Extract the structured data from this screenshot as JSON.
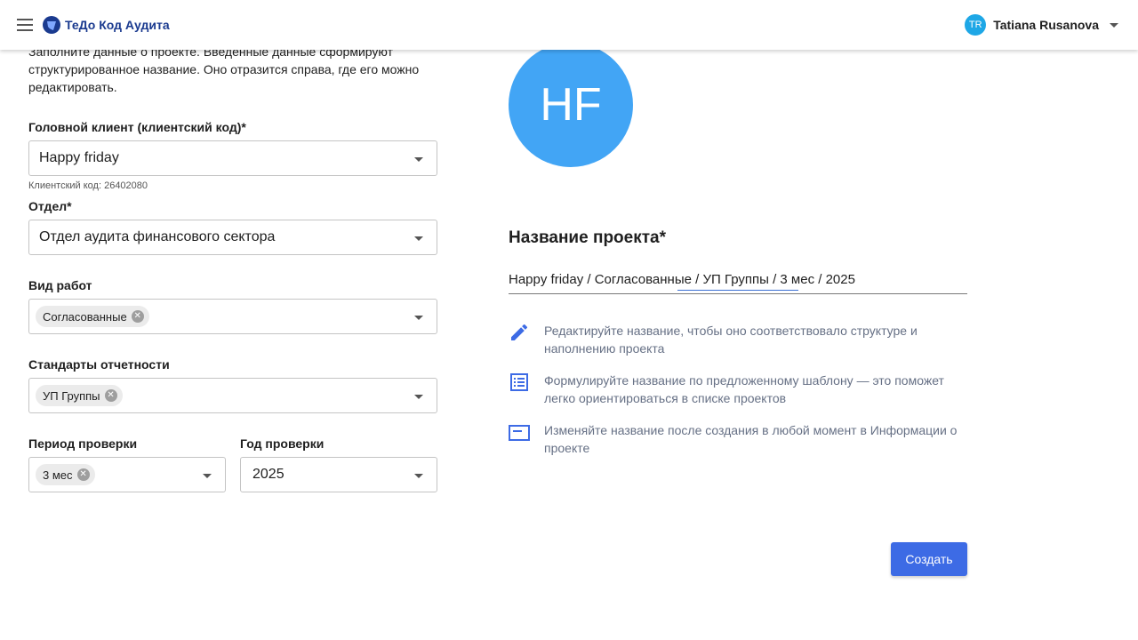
{
  "header": {
    "app_title": "ТеДо Код Аудита",
    "user_initials": "TR",
    "user_name": "Tatiana Rusanova"
  },
  "intro_text": "Заполните данные о проекте. Введенные данные сформируют структурированное название. Оно отразится справа, где его можно редактировать.",
  "form": {
    "client": {
      "label": "Головной клиент (клиентский код)*",
      "value": "Happy friday",
      "hint": "Клиентский код: 26402080"
    },
    "department": {
      "label": "Отдел*",
      "value": "Отдел аудита финансового сектора"
    },
    "work_type": {
      "label": "Вид работ",
      "chip": "Согласованные"
    },
    "standards": {
      "label": "Стандарты отчетности",
      "chip": "УП Группы"
    },
    "period": {
      "label": "Период проверки",
      "chip": "3 мес"
    },
    "year": {
      "label": "Год проверки",
      "value": "2025"
    }
  },
  "project": {
    "avatar_initials": "HF",
    "title": "Название проекта*",
    "name_value": "Happy friday / Согласованные / УП Группы / 3 мес / 2025",
    "tips": [
      "Редактируйте название, чтобы оно соответствовало структуре и наполнению проекта",
      "Формулируйте название по предложенному шаблону — это поможет легко ориентироваться в списке проектов",
      "Изменяйте название после создания в любой момент в Информации о проекте"
    ],
    "tip_icons": [
      "pencil-icon",
      "list-icon",
      "card-icon"
    ]
  },
  "actions": {
    "create_label": "Создать"
  },
  "colors": {
    "accent": "#3d6be5",
    "avatar": "#42a5f5",
    "user_avatar": "#1ea7e6",
    "brand": "#1a3a8f"
  }
}
